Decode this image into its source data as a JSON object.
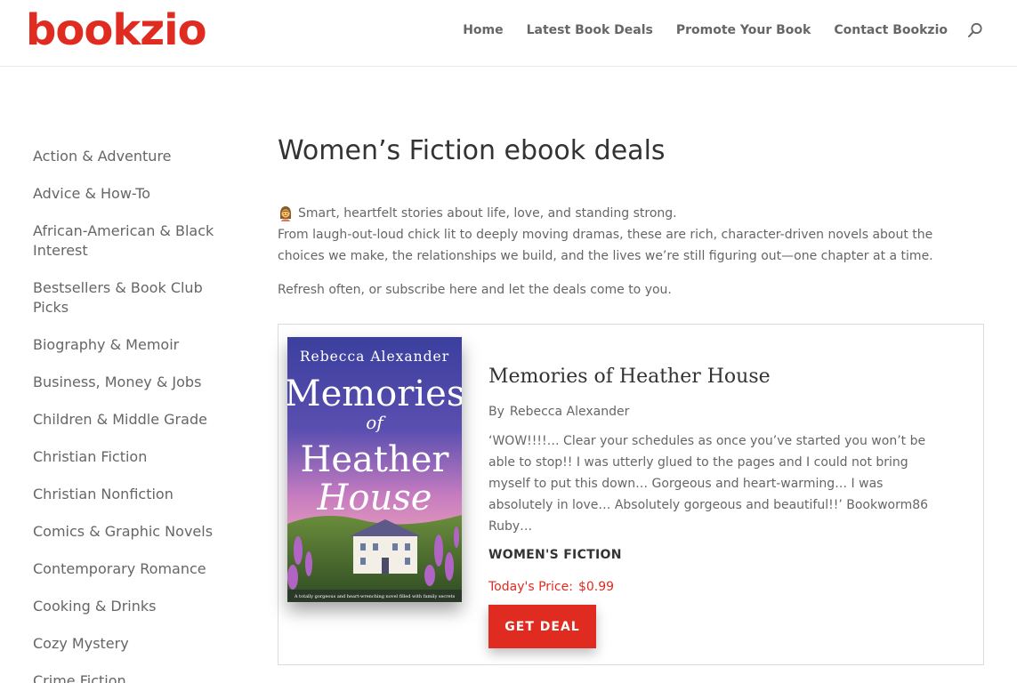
{
  "brand": {
    "logo_text": "bookzio",
    "accent": "#e02b20"
  },
  "nav": {
    "items": [
      "Home",
      "Latest Book Deals",
      "Promote Your Book",
      "Contact Bookzio"
    ],
    "search_icon": "search-icon"
  },
  "sidebar": {
    "categories": [
      "Action & Adventure",
      "Advice & How-To",
      "African-American & Black Interest",
      "Bestsellers & Book Club Picks",
      "Biography & Memoir",
      "Business, Money & Jobs",
      "Children & Middle Grade",
      "Christian Fiction",
      "Christian Nonfiction",
      "Comics & Graphic Novels",
      "Contemporary Romance",
      "Cooking & Drinks",
      "Cozy Mystery",
      "Crime Fiction"
    ]
  },
  "main": {
    "title": "Women’s Fiction ebook deals",
    "intro_lead_icon": "woman-emoji-icon",
    "intro_lead": "Smart, heartfelt stories about life, love, and standing strong.",
    "intro_body": "From laugh-out-loud chick lit to deeply moving dramas, these are rich, character-driven novels about the choices we make, the relationships we build, and the lives we’re still figuring out—one chapter at a time.",
    "refresh_text": "Refresh often, or subscribe here and let the deals come to you."
  },
  "deal": {
    "cover": {
      "author": "Rebecca Alexander",
      "title_line1": "Memories",
      "title_line2": "of",
      "title_line3": "Heather",
      "title_line4": "House",
      "tagline": "A totally gorgeous and heart-wrenching novel filled with family secrets"
    },
    "title": "Memories of Heather House",
    "by_label": "By",
    "author": "Rebecca Alexander",
    "blurb": "‘WOW!!!!… Clear your schedules as once you’ve started you won’t be able to stop!! I was utterly glued to the pages and I could not bring myself to put this down… Gorgeous and heart-warming… I was absolutely in love… Absolutely gorgeous and beautiful!!’ Bookworm86 Ruby…",
    "genre": "WOMEN'S FICTION",
    "price_label": "Today's Price:",
    "price": "$0.99",
    "button_label": "GET DEAL"
  }
}
